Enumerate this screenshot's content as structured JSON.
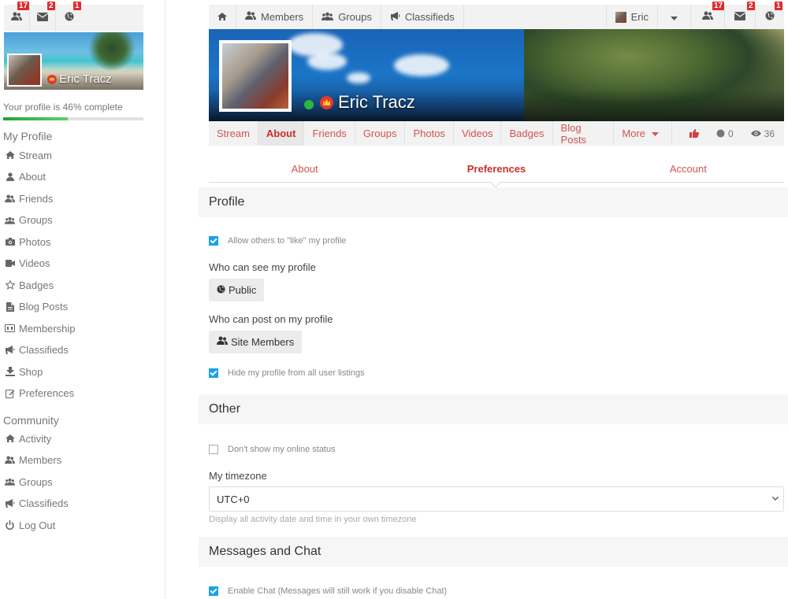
{
  "sidebar": {
    "notifications": [
      {
        "icon": "friends-icon",
        "count": "17"
      },
      {
        "icon": "envelope-icon",
        "count": "2"
      },
      {
        "icon": "globe-icon",
        "count": "1"
      }
    ],
    "user_name": "Eric Tracz",
    "profile_progress_label": "Your profile is 46% complete",
    "profile_progress_percent": 46,
    "my_profile_heading": "My Profile",
    "my_profile_items": [
      {
        "icon": "home-icon",
        "label": "Stream"
      },
      {
        "icon": "user-icon",
        "label": "About"
      },
      {
        "icon": "friends-icon",
        "label": "Friends"
      },
      {
        "icon": "groups-icon",
        "label": "Groups"
      },
      {
        "icon": "camera-icon",
        "label": "Photos"
      },
      {
        "icon": "video-icon",
        "label": "Videos"
      },
      {
        "icon": "star-icon",
        "label": "Badges"
      },
      {
        "icon": "document-icon",
        "label": "Blog Posts"
      },
      {
        "icon": "id-card-icon",
        "label": "Membership"
      },
      {
        "icon": "megaphone-icon",
        "label": "Classifieds"
      },
      {
        "icon": "download-icon",
        "label": "Shop"
      },
      {
        "icon": "edit-icon",
        "label": "Preferences"
      }
    ],
    "community_heading": "Community",
    "community_items": [
      {
        "icon": "home-icon",
        "label": "Activity"
      },
      {
        "icon": "friends-icon",
        "label": "Members"
      },
      {
        "icon": "groups-icon",
        "label": "Groups"
      },
      {
        "icon": "megaphone-icon",
        "label": "Classifieds"
      },
      {
        "icon": "power-icon",
        "label": "Log Out"
      }
    ]
  },
  "topnav": {
    "home_icon": "home-icon",
    "members": "Members",
    "groups": "Groups",
    "classifieds": "Classifieds",
    "user": "Eric",
    "notifications": [
      {
        "icon": "friends-icon",
        "count": "17"
      },
      {
        "icon": "envelope-icon",
        "count": "2"
      },
      {
        "icon": "globe-icon",
        "count": "1"
      }
    ]
  },
  "cover": {
    "user_name": "Eric Tracz",
    "online": true
  },
  "profile_tabs": {
    "items": [
      "Stream",
      "About",
      "Friends",
      "Groups",
      "Photos",
      "Videos",
      "Badges",
      "Blog Posts",
      "More"
    ],
    "active": "About",
    "points": "0",
    "views": "36"
  },
  "sub_tabs": {
    "items": [
      "About",
      "Preferences",
      "Account"
    ],
    "active": "Preferences"
  },
  "sections": {
    "profile": {
      "title": "Profile",
      "allow_like_label": "Allow others to \"like\" my profile",
      "allow_like_checked": true,
      "who_see_label": "Who can see my profile",
      "who_see_value": "Public",
      "who_post_label": "Who can post on my profile",
      "who_post_value": "Site Members",
      "hide_listings_label": "Hide my profile from all user listings",
      "hide_listings_checked": true
    },
    "other": {
      "title": "Other",
      "hide_online_label": "Don't show my online status",
      "hide_online_checked": false,
      "timezone_label": "My timezone",
      "timezone_value": "UTC+0",
      "timezone_help": "Display all activity date and time in your own timezone"
    },
    "messages": {
      "title": "Messages and Chat",
      "enable_chat_label": "Enable Chat (Messages will still work if you disable Chat)",
      "enable_chat_checked": true
    }
  }
}
